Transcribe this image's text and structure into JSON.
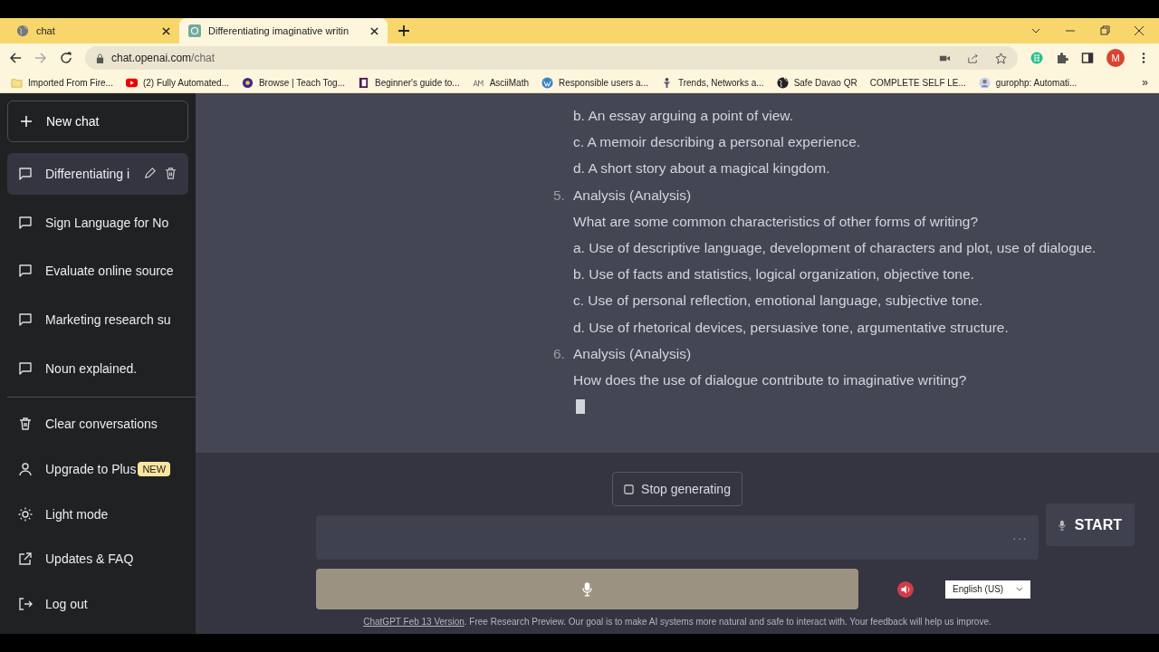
{
  "browser": {
    "tabs": [
      {
        "title": "chat",
        "selected": false
      },
      {
        "title": "Differentiating imaginative writin",
        "selected": true
      }
    ],
    "url_host": "chat.openai.com",
    "url_path": "/chat",
    "profile_initial": "M",
    "bookmarks": [
      "Imported From Fire...",
      "(2) Fully Automated...",
      "Browse | Teach Tog...",
      "Beginner's guide to...",
      "AsciiMath",
      "Responsible users a...",
      "Trends, Networks a...",
      "Safe Davao QR",
      "COMPLETE SELF LE...",
      "gurophp: Automati..."
    ],
    "more_bookmarks": "»"
  },
  "sidebar": {
    "new_chat": "New chat",
    "conversations": [
      {
        "title": "Differentiating i",
        "selected": true
      },
      {
        "title": "Sign Language for No",
        "selected": false
      },
      {
        "title": "Evaluate online source",
        "selected": false
      },
      {
        "title": "Marketing research su",
        "selected": false
      },
      {
        "title": "Noun explained.",
        "selected": false
      }
    ],
    "menu": [
      {
        "label": "Clear conversations"
      },
      {
        "label": "Upgrade to Plus",
        "badge": "NEW"
      },
      {
        "label": "Light mode"
      },
      {
        "label": "Updates & FAQ"
      },
      {
        "label": "Log out"
      }
    ]
  },
  "message": {
    "streaming": true,
    "items": [
      {
        "lines": [
          "b. An essay arguing a point of view.",
          "c. A memoir describing a personal experience.",
          "d. A short story about a magical kingdom."
        ]
      },
      {
        "number": "5.",
        "lines": [
          "Analysis (Analysis)",
          "What are some common characteristics of other forms of writing?",
          "a. Use of descriptive language, development of characters and plot, use of dialogue.",
          "b. Use of facts and statistics, logical organization, objective tone.",
          "c. Use of personal reflection, emotional language, subjective tone.",
          "d. Use of rhetorical devices, persuasive tone, argumentative structure."
        ]
      },
      {
        "number": "6.",
        "lines": [
          "Analysis (Analysis)",
          "How does the use of dialogue contribute to imaginative writing?"
        ]
      }
    ]
  },
  "stop_button": "Stop generating",
  "start_button": "START",
  "input_more": "···",
  "language": "English (US)",
  "footer": {
    "link": "ChatGPT Feb 13 Version",
    "text": ". Free Research Preview. Our goal is to make AI systems more natural and safe to interact with. Your feedback will help us improve."
  }
}
